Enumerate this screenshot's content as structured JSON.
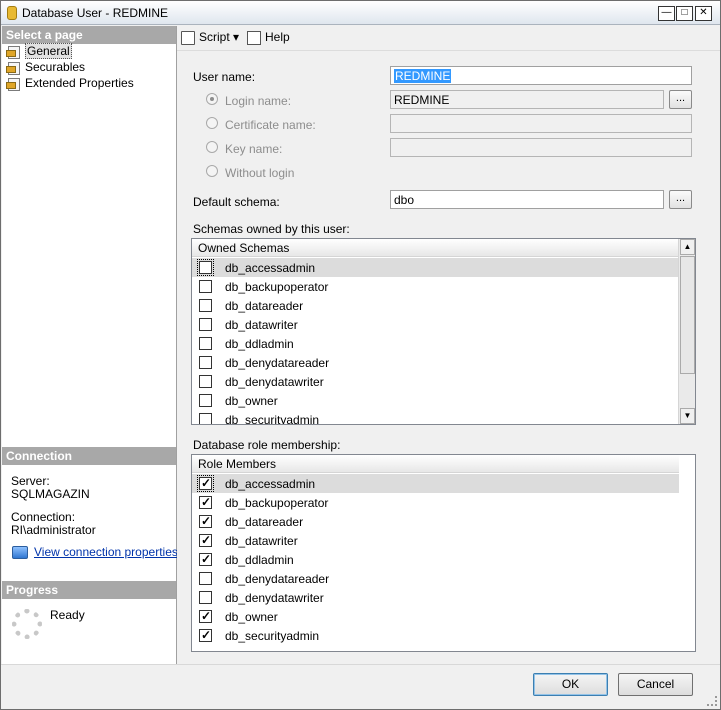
{
  "window": {
    "title": "Database User - REDMINE",
    "min": "0",
    "max": "1",
    "close": "r"
  },
  "left_panel": {
    "select_page_header": "Select a page",
    "pages": [
      {
        "label": "General",
        "selected": true
      },
      {
        "label": "Securables",
        "selected": false
      },
      {
        "label": "Extended Properties",
        "selected": false
      }
    ],
    "connection_header": "Connection",
    "server_label": "Server:",
    "server_value": "SQLMAGAZIN",
    "connection_label": "Connection:",
    "connection_value": "RI\\administrator",
    "view_connection_link": "View connection properties",
    "progress_header": "Progress",
    "progress_status": "Ready"
  },
  "toolbar": {
    "script_label": "Script",
    "help_label": "Help"
  },
  "general": {
    "user_name_label": "User name:",
    "user_name_value": "REDMINE",
    "login_name_label": "Login name:",
    "login_name_value": "REDMINE",
    "certificate_name_label": "Certificate name:",
    "key_name_label": "Key name:",
    "without_login_label": "Without login",
    "default_schema_label": "Default schema:",
    "default_schema_value": "dbo",
    "ellipsis": "...",
    "schemas_owned_label": "Schemas owned by this user:",
    "schemas_header": "Owned Schemas",
    "schemas": [
      {
        "name": "db_accessadmin",
        "checked": false
      },
      {
        "name": "db_backupoperator",
        "checked": false
      },
      {
        "name": "db_datareader",
        "checked": false
      },
      {
        "name": "db_datawriter",
        "checked": false
      },
      {
        "name": "db_ddladmin",
        "checked": false
      },
      {
        "name": "db_denydatareader",
        "checked": false
      },
      {
        "name": "db_denydatawriter",
        "checked": false
      },
      {
        "name": "db_owner",
        "checked": false
      },
      {
        "name": "db_securityadmin",
        "checked": false
      }
    ],
    "role_membership_label": "Database role membership:",
    "roles_header": "Role Members",
    "roles": [
      {
        "name": "db_accessadmin",
        "checked": true
      },
      {
        "name": "db_backupoperator",
        "checked": true
      },
      {
        "name": "db_datareader",
        "checked": true
      },
      {
        "name": "db_datawriter",
        "checked": true
      },
      {
        "name": "db_ddladmin",
        "checked": true
      },
      {
        "name": "db_denydatareader",
        "checked": false
      },
      {
        "name": "db_denydatawriter",
        "checked": false
      },
      {
        "name": "db_owner",
        "checked": true
      },
      {
        "name": "db_securityadmin",
        "checked": true
      }
    ]
  },
  "buttons": {
    "ok": "OK",
    "cancel": "Cancel"
  }
}
